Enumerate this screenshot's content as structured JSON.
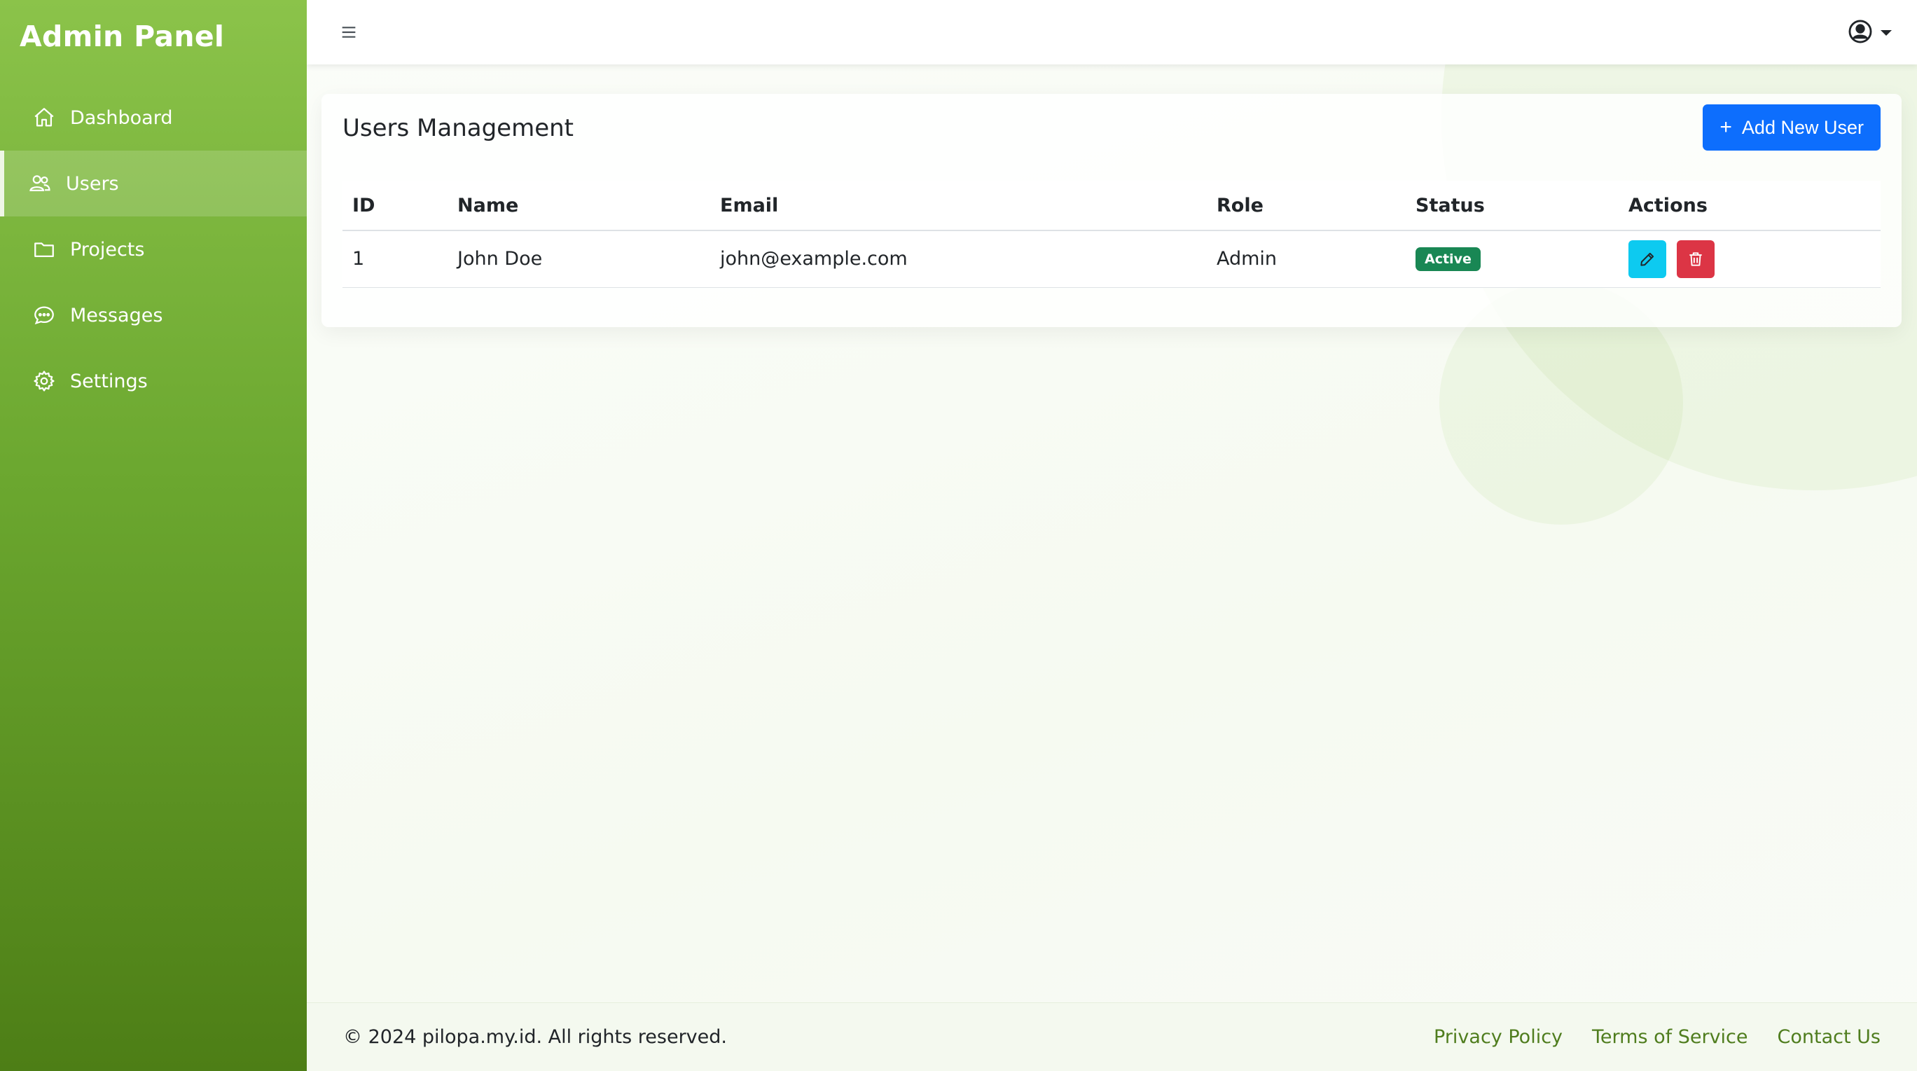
{
  "app": {
    "brand": "Admin Panel"
  },
  "sidebar": {
    "items": [
      {
        "label": "Dashboard",
        "icon": "home-icon",
        "active": false
      },
      {
        "label": "Users",
        "icon": "users-icon",
        "active": true
      },
      {
        "label": "Projects",
        "icon": "folder-icon",
        "active": false
      },
      {
        "label": "Messages",
        "icon": "chat-icon",
        "active": false
      },
      {
        "label": "Settings",
        "icon": "gear-icon",
        "active": false
      }
    ]
  },
  "topbar": {
    "menu_icon": "hamburger-icon",
    "user_icon": "user-circle-icon"
  },
  "main": {
    "title": "Users Management",
    "add_button": "Add New User",
    "table": {
      "headers": [
        "ID",
        "Name",
        "Email",
        "Role",
        "Status",
        "Actions"
      ],
      "rows": [
        {
          "id": "1",
          "name": "John Doe",
          "email": "john@example.com",
          "role": "Admin",
          "status": "Active"
        }
      ]
    }
  },
  "footer": {
    "copyright": "© 2024 pilopa.my.id. All rights reserved.",
    "links": [
      "Privacy Policy",
      "Terms of Service",
      "Contact Us"
    ]
  },
  "colors": {
    "sidebar_top": "#8bc34a",
    "sidebar_bottom": "#4d7e16",
    "primary": "#0d6efd",
    "success": "#198754",
    "info": "#0dcaf0",
    "danger": "#dc3545",
    "footer_link": "#4f7d1e"
  }
}
